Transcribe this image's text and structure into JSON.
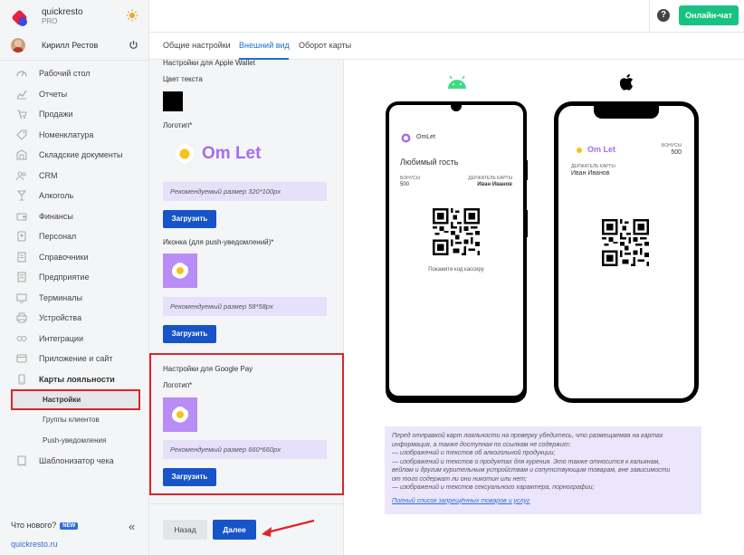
{
  "brand": {
    "name": "quickresto",
    "plan": "PRO"
  },
  "user": {
    "name": "Кирилл Рестов"
  },
  "sidebar": {
    "items": [
      {
        "label": "Рабочий стол",
        "icon": "dashboard-icon"
      },
      {
        "label": "Отчеты",
        "icon": "chart-icon"
      },
      {
        "label": "Продажи",
        "icon": "cart-icon"
      },
      {
        "label": "Номенклатура",
        "icon": "tag-icon"
      },
      {
        "label": "Складские документы",
        "icon": "warehouse-icon"
      },
      {
        "label": "CRM",
        "icon": "people-icon"
      },
      {
        "label": "Алкоголь",
        "icon": "glass-icon"
      },
      {
        "label": "Финансы",
        "icon": "wallet-icon"
      },
      {
        "label": "Персонал",
        "icon": "person-icon"
      },
      {
        "label": "Справочники",
        "icon": "book-icon"
      },
      {
        "label": "Предприятие",
        "icon": "building-icon"
      },
      {
        "label": "Терминалы",
        "icon": "terminal-icon"
      },
      {
        "label": "Устройства",
        "icon": "printer-icon"
      },
      {
        "label": "Интеграции",
        "icon": "link-icon"
      },
      {
        "label": "Приложение и сайт",
        "icon": "app-icon"
      },
      {
        "label": "Карты лояльности",
        "icon": "loyalty-card-icon"
      }
    ],
    "sub_items": [
      {
        "label": "Настройки"
      },
      {
        "label": "Группы клиентов"
      },
      {
        "label": "Push-уведомления"
      }
    ],
    "last_item": {
      "label": "Шаблонизатор чека"
    },
    "whats_new": "Что нового?",
    "new_badge": "NEW",
    "site_link": "quickresto.ru"
  },
  "topbar": {
    "help": "?",
    "chat_button": "Онлайн-чат"
  },
  "tabs": [
    {
      "label": "Общие настройки"
    },
    {
      "label": "Внешний вид",
      "active": true
    },
    {
      "label": "Оборот карты"
    }
  ],
  "settings": {
    "apple_title": "Настройки для Apple Wallet",
    "text_color_label": "Цвет текста",
    "text_color": "#000000",
    "logo_label": "Логотип*",
    "logo_brand": "Om Let",
    "logo_hint": "Рекомендуемый размер 320*100px",
    "upload_label": "Загрузить",
    "push_icon_label": "Иконка (для push-уведомлений)*",
    "push_icon_hint": "Рекомендуемый размер 58*58px",
    "google_title": "Настройки для Google Pay",
    "google_logo_label": "Логотип*",
    "google_logo_hint": "Рекомендуемый размер 660*660px",
    "back_button": "Назад",
    "next_button": "Далее"
  },
  "preview": {
    "android": {
      "brand": "OmLet",
      "card_title": "Любимый гость",
      "bonus_label": "БОНУСЫ",
      "bonus_value": "500",
      "holder_label": "ДЕРЖАТЕЛЬ КАРТЫ",
      "holder_value": "Иван Иванов",
      "scan_hint": "Покажите код кассиру"
    },
    "ios": {
      "brand": "Om Let",
      "bonus_label": "БОНУСЫ",
      "bonus_value": "500",
      "holder_label": "ДЕРЖАТЕЛЬ КАРТЫ",
      "holder_value": "Иван Иванов"
    },
    "notice": {
      "lines": [
        "Перед отправкой карт лояльности на проверку убедитесь, что размещаемая на картах",
        "информация, а также доступная по ссылкам не содержит:",
        "— изображений и текстов об алкогольной продукции;",
        "— изображений и текстов о продуктах для курения. Это также относится к кальянам,",
        "вейпам и другим курительным устройствам и сопутствующим товарам, вне зависимости",
        "от того содержат ли они никотин или нет;",
        "— изображений и текстов сексуального характера, порнографии;"
      ],
      "link": "Полный список запрещённых товаров и услуг"
    }
  },
  "colors": {
    "accent": "#1754c8",
    "chat": "#18c281",
    "highlight": "#d9262b",
    "hint_bg": "#e6e0fa",
    "logo_purple": "#a66df0"
  }
}
